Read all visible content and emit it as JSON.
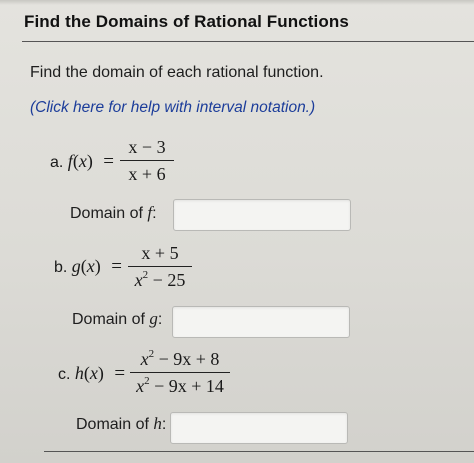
{
  "header": {
    "title": "Find the Domains of Rational Functions"
  },
  "instructions": "Find the domain of each rational function.",
  "help_link": "(Click here for help with interval notation.)",
  "problems": [
    {
      "letter": "a.",
      "fn": "f",
      "var": "x",
      "numerator": "x − 3",
      "denominator": "x + 6",
      "domain_label_prefix": "Domain of",
      "domain_label_fn": "f",
      "domain_label_suffix": ":",
      "answer_value": ""
    },
    {
      "letter": "b.",
      "fn": "g",
      "var": "x",
      "numerator": "x + 5",
      "denominator_base": "x",
      "denominator_exp": "2",
      "denominator_rest": " − 25",
      "domain_label_prefix": "Domain of",
      "domain_label_fn": "g",
      "domain_label_suffix": ":",
      "answer_value": ""
    },
    {
      "letter": "c.",
      "fn": "h",
      "var": "x",
      "numerator_base": "x",
      "numerator_exp": "2",
      "numerator_rest": " − 9x + 8",
      "denominator_base": "x",
      "denominator_exp": "2",
      "denominator_rest": " − 9x + 14",
      "domain_label_prefix": "Domain of",
      "domain_label_fn": "h",
      "domain_label_suffix": ":",
      "answer_value": ""
    }
  ],
  "colors": {
    "link": "#1c3d9a",
    "text": "#1a1a1a",
    "background": "#dcdbd6"
  }
}
